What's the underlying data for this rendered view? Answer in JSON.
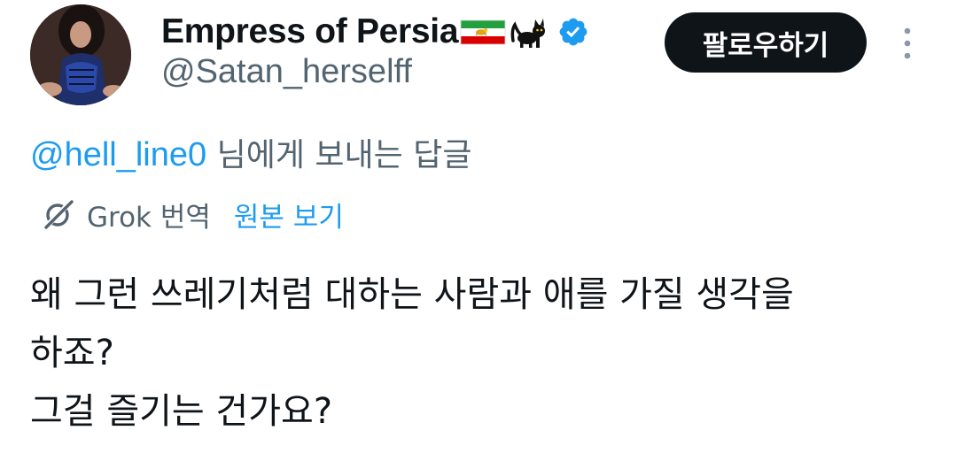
{
  "author": {
    "display_name": "Empress of Persia",
    "flag_icon": "iran-lion-and-sun-flag-icon",
    "cat_emoji": "🐈‍⬛",
    "verified_icon": "verified-badge-icon",
    "verified_color": "#1d9bf0",
    "handle": "@Satan_herselff"
  },
  "follow_button": {
    "label": "팔로우하기"
  },
  "reply": {
    "mention": "@hell_line0",
    "suffix": " 님에게 보내는 답글"
  },
  "translation": {
    "label": "Grok 번역",
    "view_original": "원본 보기"
  },
  "tweet": {
    "lines": [
      "왜 그런 쓰레기처럼 대하는 사람과 애를 가질 생각을",
      "하죠?",
      "그걸 즐기는 건가요?"
    ]
  },
  "colors": {
    "accent": "#1d9bf0",
    "secondary_text": "#536471",
    "primary_text": "#0f1419"
  }
}
